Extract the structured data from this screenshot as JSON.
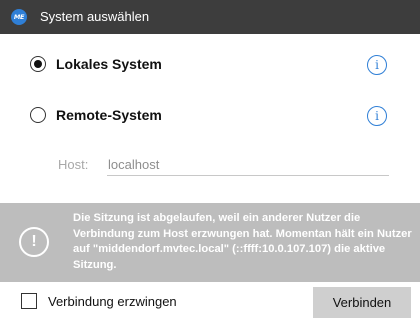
{
  "window": {
    "title": "System auswählen",
    "logo_text": "ME"
  },
  "options": {
    "local": {
      "label": "Lokales System",
      "selected": true
    },
    "remote": {
      "label": "Remote-System",
      "selected": false
    }
  },
  "host": {
    "label": "Host:",
    "value": "localhost"
  },
  "warning": {
    "icon": "!",
    "message": "Die Sitzung ist abgelaufen, weil ein anderer Nutzer die Verbindung zum Host erzwungen hat. Momentan hält ein Nutzer auf \"middendorf.mvtec.local\" (::ffff:10.0.107.107) die aktive Sitzung."
  },
  "footer": {
    "force_label": "Verbindung erzwingen",
    "connect_label": "Verbinden"
  },
  "colors": {
    "titlebar": "#3d3d3d",
    "accent": "#2f7fd6",
    "warning_bg": "#bdbdbd",
    "button_bg": "#cfcfcf"
  }
}
